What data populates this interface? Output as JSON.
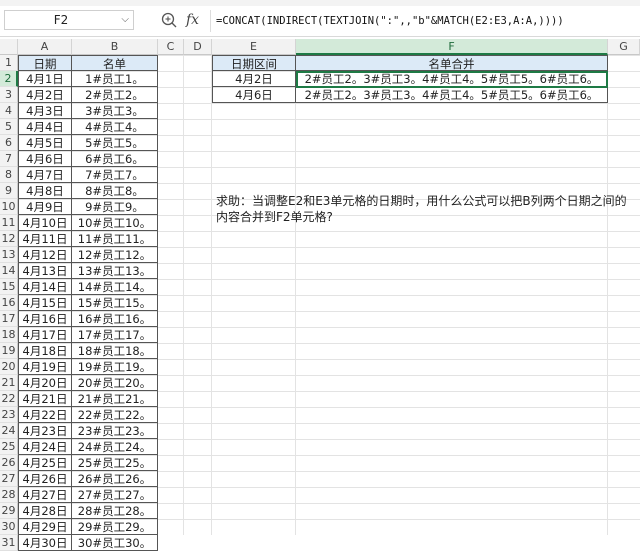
{
  "namebox": {
    "value": "F2",
    "arrow": "⌵"
  },
  "formula_bar": {
    "fx": "fx",
    "formula": "=CONCAT(INDIRECT(TEXTJOIN(\":\",,\"b\"&MATCH(E2:E3,A:A,))))"
  },
  "columns": [
    "A",
    "B",
    "C",
    "D",
    "E",
    "F",
    "G"
  ],
  "rows": [
    "1",
    "2",
    "3",
    "4",
    "5",
    "6",
    "7",
    "8",
    "9",
    "10",
    "11",
    "12",
    "13",
    "14",
    "15",
    "16",
    "17",
    "18",
    "19",
    "20",
    "21",
    "22",
    "23",
    "24",
    "25",
    "26",
    "27",
    "28",
    "29",
    "30",
    "31"
  ],
  "table_left": {
    "headers": [
      "日期",
      "名单"
    ],
    "rows": [
      [
        "4月1日",
        "1#员工1。"
      ],
      [
        "4月2日",
        "2#员工2。"
      ],
      [
        "4月3日",
        "3#员工3。"
      ],
      [
        "4月4日",
        "4#员工4。"
      ],
      [
        "4月5日",
        "5#员工5。"
      ],
      [
        "4月6日",
        "6#员工6。"
      ],
      [
        "4月7日",
        "7#员工7。"
      ],
      [
        "4月8日",
        "8#员工8。"
      ],
      [
        "4月9日",
        "9#员工9。"
      ],
      [
        "4月10日",
        "10#员工10。"
      ],
      [
        "4月11日",
        "11#员工11。"
      ],
      [
        "4月12日",
        "12#员工12。"
      ],
      [
        "4月13日",
        "13#员工13。"
      ],
      [
        "4月14日",
        "14#员工14。"
      ],
      [
        "4月15日",
        "15#员工15。"
      ],
      [
        "4月16日",
        "16#员工16。"
      ],
      [
        "4月17日",
        "17#员工17。"
      ],
      [
        "4月18日",
        "18#员工18。"
      ],
      [
        "4月19日",
        "19#员工19。"
      ],
      [
        "4月20日",
        "20#员工20。"
      ],
      [
        "4月21日",
        "21#员工21。"
      ],
      [
        "4月22日",
        "22#员工22。"
      ],
      [
        "4月23日",
        "23#员工23。"
      ],
      [
        "4月24日",
        "24#员工24。"
      ],
      [
        "4月25日",
        "25#员工25。"
      ],
      [
        "4月26日",
        "26#员工26。"
      ],
      [
        "4月27日",
        "27#员工27。"
      ],
      [
        "4月28日",
        "28#员工28。"
      ],
      [
        "4月29日",
        "29#员工29。"
      ],
      [
        "4月30日",
        "30#员工30。"
      ]
    ]
  },
  "table_right": {
    "headers": [
      "日期区间",
      "名单合并"
    ],
    "rows": [
      [
        "4月2日",
        "2#员工2。3#员工3。4#员工4。5#员工5。6#员工6。"
      ],
      [
        "4月6日",
        "2#员工2。3#员工3。4#员工4。5#员工5。6#员工6。"
      ]
    ]
  },
  "note": "求助：当调整E2和E3单元格的日期时，用什么公式可以把B列两个日期之间的内容合并到F2单元格?",
  "colors": {
    "selection": "#1e7a45",
    "header_fill": "#dceaf7"
  }
}
